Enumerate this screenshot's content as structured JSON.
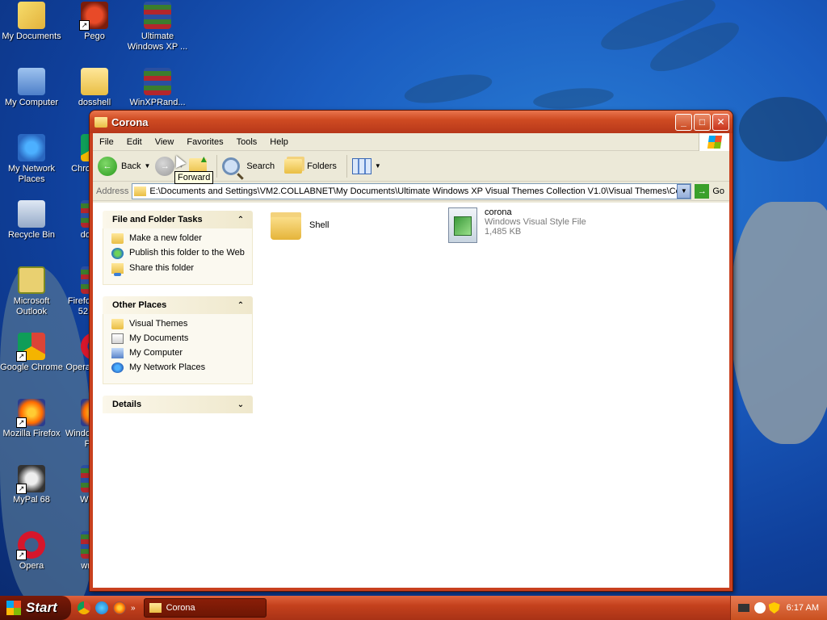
{
  "desktop": {
    "icons": [
      {
        "label": "My Documents",
        "icon": "my-documents-icon"
      },
      {
        "label": "Pego",
        "icon": "pego-icon"
      },
      {
        "label": "Ultimate Windows XP ...",
        "icon": "winrar-archive-icon"
      },
      {
        "label": "My Computer",
        "icon": "my-computer-icon"
      },
      {
        "label": "dosshell",
        "icon": "folder-icon"
      },
      {
        "label": "WinXPRand...",
        "icon": "winrar-archive-icon"
      },
      {
        "label": "My Network Places",
        "icon": "network-places-icon"
      },
      {
        "label": "Chro",
        "icon": "chrome-icon"
      },
      {
        "label": "Recycle Bin",
        "icon": "recycle-bin-icon"
      },
      {
        "label": "do",
        "icon": "winrar-archive-icon"
      },
      {
        "label": "Microsoft Outlook",
        "icon": "outlook-icon"
      },
      {
        "label": "Firefo 52.",
        "icon": "winrar-archive-icon"
      },
      {
        "label": "Google Chrome",
        "icon": "chrome-icon"
      },
      {
        "label": "Opera",
        "icon": "opera-icon"
      },
      {
        "label": "Mozilla Firefox",
        "icon": "firefox-icon"
      },
      {
        "label": "Windo P",
        "icon": "firefox-icon"
      },
      {
        "label": "MyPal 68",
        "icon": "mypal-icon"
      },
      {
        "label": "Wi",
        "icon": "winrar-archive-icon"
      },
      {
        "label": "Opera",
        "icon": "opera-icon"
      },
      {
        "label": "wr",
        "icon": "winrar-archive-icon"
      }
    ]
  },
  "window": {
    "title": "Corona",
    "menu": [
      "File",
      "Edit",
      "View",
      "Favorites",
      "Tools",
      "Help"
    ],
    "toolbar": {
      "back": "Back",
      "search": "Search",
      "folders": "Folders"
    },
    "tooltip": "Forward",
    "address": {
      "label": "Address",
      "value": "E:\\Documents and Settings\\VM2.COLLABNET\\My Documents\\Ultimate Windows XP Visual Themes Collection V1.0\\Visual Themes\\Corona",
      "go": "Go"
    },
    "panels": {
      "tasks": {
        "title": "File and Folder Tasks",
        "items": [
          "Make a new folder",
          "Publish this folder to the Web",
          "Share this folder"
        ]
      },
      "other": {
        "title": "Other Places",
        "items": [
          "Visual Themes",
          "My Documents",
          "My Computer",
          "My Network Places"
        ]
      },
      "details": {
        "title": "Details"
      }
    },
    "files": [
      {
        "name": "Shell",
        "type": "",
        "size": ""
      },
      {
        "name": "corona",
        "type": "Windows Visual Style File",
        "size": "1,485 KB"
      }
    ]
  },
  "taskbar": {
    "start": "Start",
    "task": "Corona",
    "clock": "6:17 AM"
  }
}
